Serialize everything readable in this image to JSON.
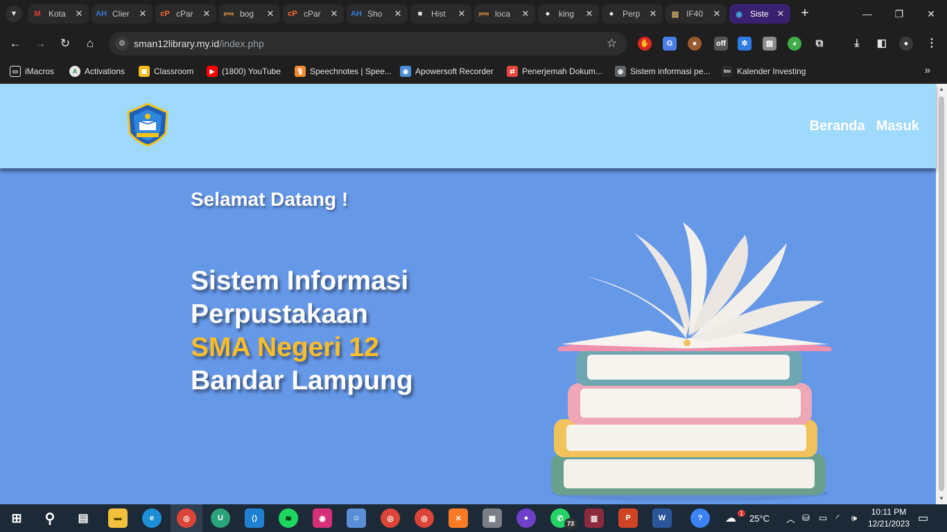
{
  "browser": {
    "tabs": [
      {
        "title": "Kota",
        "favicon": "gmail-icon",
        "color": "#ea4335",
        "glyph": "M"
      },
      {
        "title": "Clier",
        "favicon": "ah-icon",
        "color": "#3a7bd5",
        "glyph": "AH"
      },
      {
        "title": "cPar",
        "favicon": "cpanel-icon",
        "color": "#ff6c2c",
        "glyph": "cP"
      },
      {
        "title": "bog",
        "favicon": "xampp-icon",
        "color": "#f4a23a",
        "glyph": "pma"
      },
      {
        "title": "cPar",
        "favicon": "cpanel-icon",
        "color": "#ff6c2c",
        "glyph": "cP"
      },
      {
        "title": "Sho",
        "favicon": "ah-icon",
        "color": "#3a7bd5",
        "glyph": "AH"
      },
      {
        "title": "Hist",
        "favicon": "chat-icon",
        "color": "#e3e3e3",
        "glyph": "■"
      },
      {
        "title": "loca",
        "favicon": "xampp-icon",
        "color": "#f4a23a",
        "glyph": "pma"
      },
      {
        "title": "king",
        "favicon": "github-icon",
        "color": "#ffffff",
        "glyph": "●"
      },
      {
        "title": "Perp",
        "favicon": "github-icon",
        "color": "#ffffff",
        "glyph": "●"
      },
      {
        "title": "IF40",
        "favicon": "document-icon",
        "color": "#d7b46a",
        "glyph": "▤"
      },
      {
        "title": "Siste",
        "favicon": "school-logo-icon",
        "color": "#4aa3df",
        "glyph": "◉",
        "active": true
      }
    ],
    "new_tab_label": "+",
    "window_controls": {
      "minimize": "—",
      "restore": "❐",
      "close": "✕"
    },
    "url_host": "sman12library.my.id",
    "url_path": "/index.php",
    "bookmarks": [
      {
        "label": "iMacros",
        "icon": "folder-icon",
        "color": "#1f1f1f",
        "glyph": "▭"
      },
      {
        "label": "Activations",
        "icon": "activations-icon",
        "color": "#e8e8e8",
        "glyph": "A"
      },
      {
        "label": "Classroom",
        "icon": "classroom-icon",
        "color": "#f6bb18",
        "glyph": "▣"
      },
      {
        "label": "(1800) YouTube",
        "icon": "youtube-icon",
        "color": "#ff0000",
        "glyph": "▶"
      },
      {
        "label": "Speechnotes | Spee...",
        "icon": "microphone-icon",
        "color": "#f28b30",
        "glyph": "🎙"
      },
      {
        "label": "Apowersoft Recorder",
        "icon": "recorder-icon",
        "color": "#4a90d9",
        "glyph": "◉"
      },
      {
        "label": "Penerjemah Dokum...",
        "icon": "translate-icon",
        "color": "#e8453c",
        "glyph": "⇄"
      },
      {
        "label": "Sistem informasi pe...",
        "icon": "globe-icon",
        "color": "#5f6368",
        "glyph": "◍"
      },
      {
        "label": "Kalender Investing",
        "icon": "investing-icon",
        "color": "#2b2b2b",
        "glyph": "Inv"
      }
    ]
  },
  "site": {
    "nav": [
      {
        "label": "Beranda"
      },
      {
        "label": "Masuk"
      }
    ],
    "hero": {
      "welcome": "Selamat Datang !",
      "title_line1": "Sistem Informasi",
      "title_line2": "Perpustakaan",
      "title_highlight": "SMA Negeri 12",
      "title_line4": "Bandar Lampung"
    },
    "colors": {
      "header_bg": "#9fd9fc",
      "hero_bg": "#6698e8",
      "highlight": "#fbbd2a"
    }
  },
  "taskbar": {
    "weather": "25°C",
    "weather_badge": "1",
    "whatsapp_badge": "73",
    "time": "10:11 PM",
    "date": "12/21/2023"
  }
}
